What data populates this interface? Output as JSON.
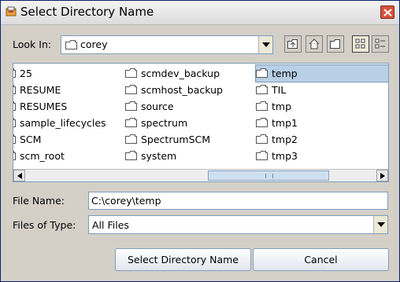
{
  "window": {
    "title": "Select Directory Name"
  },
  "look_in": {
    "label": "Look In:",
    "value": "corey"
  },
  "toolbar": {
    "icons": [
      "up-one-level-icon",
      "home-icon",
      "new-folder-icon",
      "list-view-icon",
      "details-view-icon"
    ]
  },
  "files": {
    "col1": [
      "25",
      "RESUME",
      "RESUMES",
      "sample_lifecycles",
      "SCM",
      "scm_root"
    ],
    "col2": [
      "scmdev_backup",
      "scmhost_backup",
      "source",
      "spectrum",
      "SpectrumSCM",
      "system"
    ],
    "col3": [
      "temp",
      "TIL",
      "tmp",
      "tmp1",
      "tmp2",
      "tmp3"
    ],
    "selected": "temp"
  },
  "file_name": {
    "label": "File Name:",
    "value": "C:\\corey\\temp"
  },
  "file_type": {
    "label": "Files of Type:",
    "value": "All Files"
  },
  "buttons": {
    "select": "Select Directory Name",
    "cancel": "Cancel"
  },
  "colors": {
    "selection": "#b8cfe5",
    "border": "#7f9db9",
    "close": "#d4543c"
  }
}
